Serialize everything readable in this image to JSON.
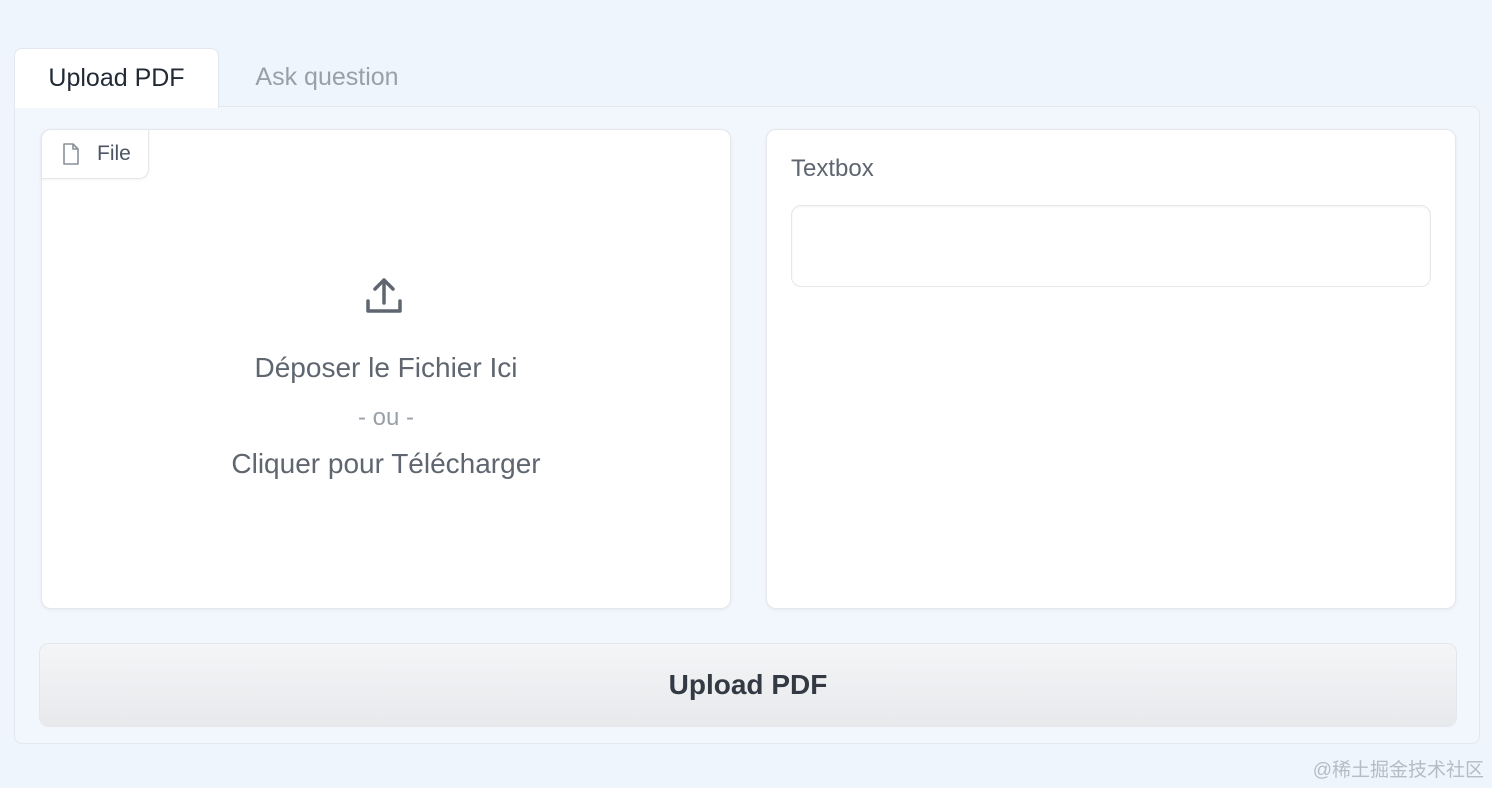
{
  "tabs": [
    {
      "label": "Upload PDF",
      "active": true
    },
    {
      "label": "Ask question",
      "active": false
    }
  ],
  "file_upload": {
    "label": "File",
    "drop_text": "Déposer le Fichier Ici",
    "or_text": "- ou -",
    "click_text": "Cliquer pour Télécharger"
  },
  "textbox": {
    "label": "Textbox",
    "value": "",
    "placeholder": ""
  },
  "upload_button": {
    "label": "Upload PDF"
  },
  "watermark": "@稀土掘金技术社区",
  "icons": {
    "file": "file-icon",
    "upload": "upload-icon"
  },
  "colors": {
    "background": "#eef5fd",
    "panel": "#ffffff",
    "text_primary": "#222a35",
    "text_muted": "#9aa0a8"
  }
}
